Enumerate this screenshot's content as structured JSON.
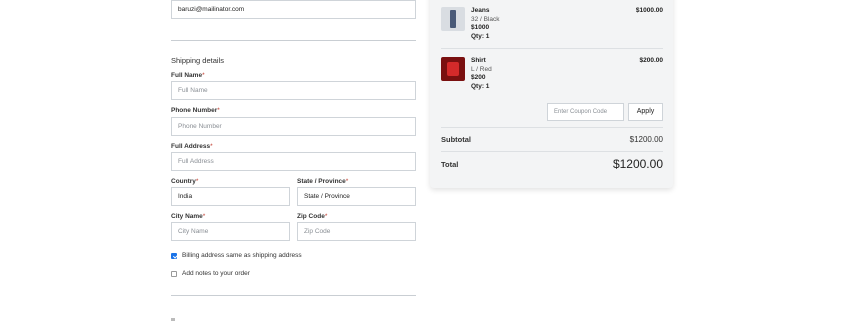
{
  "form": {
    "email_value": "baruzi@mailinator.com",
    "shipping_title": "Shipping details",
    "required_mark": "*",
    "full_name": {
      "label": "Full Name",
      "placeholder": "Full Name"
    },
    "phone": {
      "label": "Phone Number",
      "placeholder": "Phone Number"
    },
    "address": {
      "label": "Full Address",
      "placeholder": "Full Address"
    },
    "country": {
      "label": "Country",
      "value": "India"
    },
    "state": {
      "label": "State / Province",
      "placeholder": "State / Province"
    },
    "city": {
      "label": "City Name",
      "placeholder": "City Name"
    },
    "zip": {
      "label": "Zip Code",
      "placeholder": "Zip Code"
    },
    "billing_same": {
      "label": "Billing address same as shipping address",
      "checked": true
    },
    "add_notes": {
      "label": "Add notes to your order",
      "checked": false
    }
  },
  "summary": {
    "items": [
      {
        "name": "Jeans",
        "variant": "32 / Black",
        "price": "$1000",
        "qty": "Qty: 1",
        "total": "$1000.00",
        "image": "jeans-image"
      },
      {
        "name": "Shirt",
        "variant": "L / Red",
        "price": "$200",
        "qty": "Qty: 1",
        "total": "$200.00",
        "image": "shirt-image"
      }
    ],
    "coupon_placeholder": "Enter Coupon Code",
    "apply_label": "Apply",
    "subtotal_label": "Subtotal",
    "subtotal_value": "$1200.00",
    "total_label": "Total",
    "total_value": "$1200.00"
  },
  "colors": {
    "checkbox_checked": "#1a73e8",
    "required": "#c0392b",
    "panel_bg": "#f3f4f5"
  }
}
